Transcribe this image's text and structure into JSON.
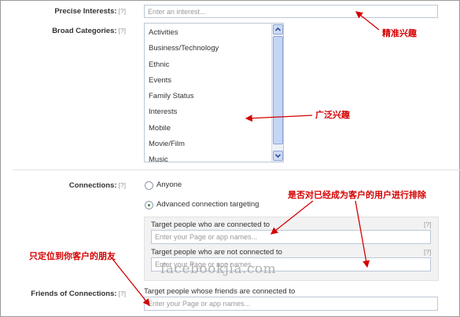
{
  "precise_interests": {
    "label": "Precise Interests:",
    "help": "[?]",
    "placeholder": "Enter an interest..."
  },
  "broad_categories": {
    "label": "Broad Categories:",
    "help": "[?]",
    "items": [
      {
        "label": "Activities"
      },
      {
        "label": "Business/Technology"
      },
      {
        "label": "Ethnic"
      },
      {
        "label": "Events"
      },
      {
        "label": "Family Status"
      },
      {
        "label": "Interests"
      },
      {
        "label": "Mobile"
      },
      {
        "label": "Movie/Film"
      },
      {
        "label": "Music"
      }
    ]
  },
  "connections": {
    "label": "Connections:",
    "help": "[?]",
    "options": [
      {
        "label": "Anyone",
        "selected": false
      },
      {
        "label": "Advanced connection targeting",
        "selected": true
      }
    ],
    "connected_to": {
      "label": "Target people who are connected to",
      "help": "[?]",
      "placeholder": "Enter your Page or app names..."
    },
    "not_connected_to": {
      "label": "Target people who are not connected to",
      "help": "[?]",
      "placeholder": "Enter your Page or app names..."
    }
  },
  "friends_of_connections": {
    "label": "Friends of Connections:",
    "help": "[?]",
    "sublabel": "Target people whose friends are connected to",
    "placeholder": "Enter your Page or app names..."
  },
  "annotations": {
    "precise": "精准兴趣",
    "broad": "广泛兴趣",
    "exclude": "是否对已经成为客户的用户进行排除",
    "friends": "只定位到你客户的朋友"
  },
  "watermark": "facebookjia.com",
  "colors": {
    "annotation": "#d40000",
    "input_border": "#bdc7d8",
    "scroll_thumb": "#c5d5f6"
  }
}
